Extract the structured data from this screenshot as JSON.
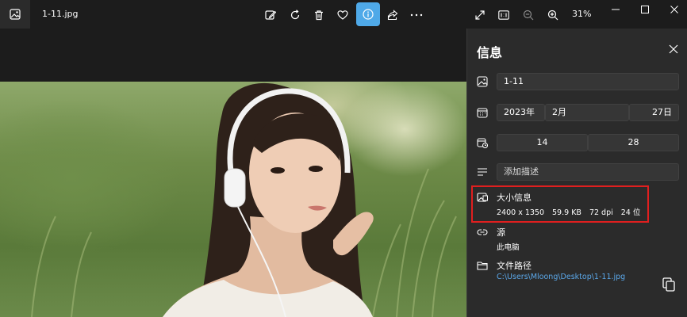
{
  "window": {
    "file_name": "1-11.jpg",
    "zoom_label": "31%"
  },
  "toolbar": {
    "actions": [
      "edit-image-icon",
      "rotate-icon",
      "delete-icon",
      "favorite-icon",
      "info-icon",
      "share-icon",
      "more-icon"
    ],
    "active": "info-icon"
  },
  "panel": {
    "title": "信息",
    "name_value": "1-11",
    "date": {
      "year": "2023年",
      "month": "2月",
      "day": "27日"
    },
    "time": {
      "hour": "14",
      "minute": "28"
    },
    "description_placeholder": "添加描述",
    "size_info": {
      "title": "大小信息",
      "dimensions": "2400 x 1350",
      "file_size": "59.9 KB",
      "dpi": "72 dpi",
      "bit_depth": "24 位"
    },
    "source": {
      "title": "源",
      "value": "此电脑"
    },
    "file_path": {
      "title": "文件路径",
      "value": "C:\\Users\\Mloong\\Desktop\\1-11.jpg"
    }
  },
  "colors": {
    "accent": "#4fa9e8",
    "highlight_box": "#e01f1f",
    "link": "#5ba8ea",
    "panel_bg": "#2b2b2b",
    "app_bg": "#1c1c1c"
  }
}
